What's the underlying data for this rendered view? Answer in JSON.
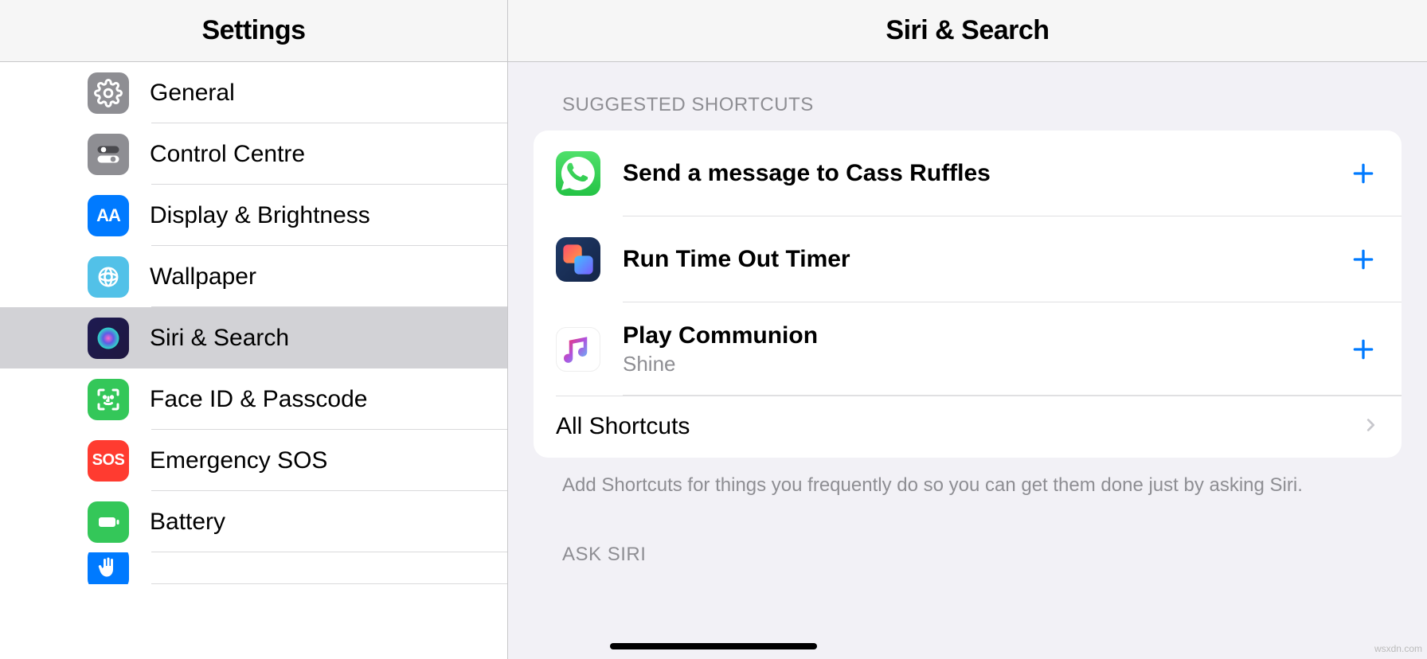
{
  "sidebar": {
    "title": "Settings",
    "items": [
      {
        "id": "general",
        "label": "General"
      },
      {
        "id": "control-centre",
        "label": "Control Centre"
      },
      {
        "id": "display-brightness",
        "label": "Display & Brightness"
      },
      {
        "id": "wallpaper",
        "label": "Wallpaper"
      },
      {
        "id": "siri-search",
        "label": "Siri & Search",
        "selected": true
      },
      {
        "id": "face-id-passcode",
        "label": "Face ID & Passcode"
      },
      {
        "id": "emergency-sos",
        "label": "Emergency SOS"
      },
      {
        "id": "battery",
        "label": "Battery"
      }
    ]
  },
  "detail": {
    "title": "Siri & Search",
    "suggested_header": "SUGGESTED SHORTCUTS",
    "shortcuts": [
      {
        "app": "whatsapp",
        "title": "Send a message to Cass Ruffles",
        "subtitle": ""
      },
      {
        "app": "shortcuts",
        "title": "Run Time Out Timer",
        "subtitle": ""
      },
      {
        "app": "music",
        "title": "Play Communion",
        "subtitle": "Shine"
      }
    ],
    "all_shortcuts_label": "All Shortcuts",
    "footer": "Add Shortcuts for things you frequently do so you can get them done just by asking Siri.",
    "ask_siri_header": "ASK SIRI"
  },
  "watermark": "wsxdn.com"
}
